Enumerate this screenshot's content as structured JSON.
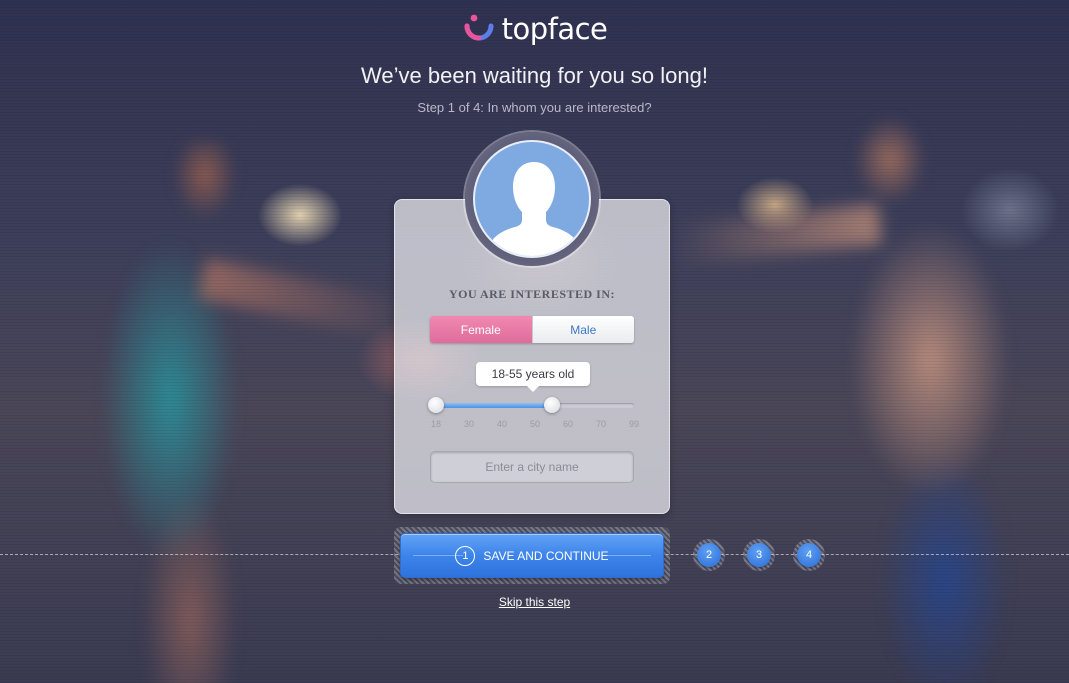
{
  "brand": {
    "name": "topface",
    "logo_icon": "topface-smile-icon",
    "logo_colors": [
      "#e8559a",
      "#5d7ee8"
    ]
  },
  "header": {
    "headline": "We’ve been waiting for you so long!",
    "subhead": "Step 1 of 4: In whom you are interested?"
  },
  "card": {
    "avatar_icon": "user-silhouette-icon",
    "interest_title": "YOU ARE INTERESTED IN:",
    "gender_options": [
      {
        "label": "Female",
        "selected": true
      },
      {
        "label": "Male",
        "selected": false
      }
    ],
    "age": {
      "label": "18-55 years old",
      "min": 18,
      "max": 99,
      "selected_min": 18,
      "selected_max": 55,
      "ticks": [
        "18",
        "30",
        "40",
        "50",
        "60",
        "70",
        "99"
      ]
    },
    "city": {
      "placeholder": "Enter a city name",
      "value": ""
    }
  },
  "steps": {
    "current": "1",
    "save_label": "SAVE AND CONTINUE",
    "others": [
      "2",
      "3",
      "4"
    ],
    "accent": "#3d84ea"
  },
  "skip_label": "Skip this step"
}
